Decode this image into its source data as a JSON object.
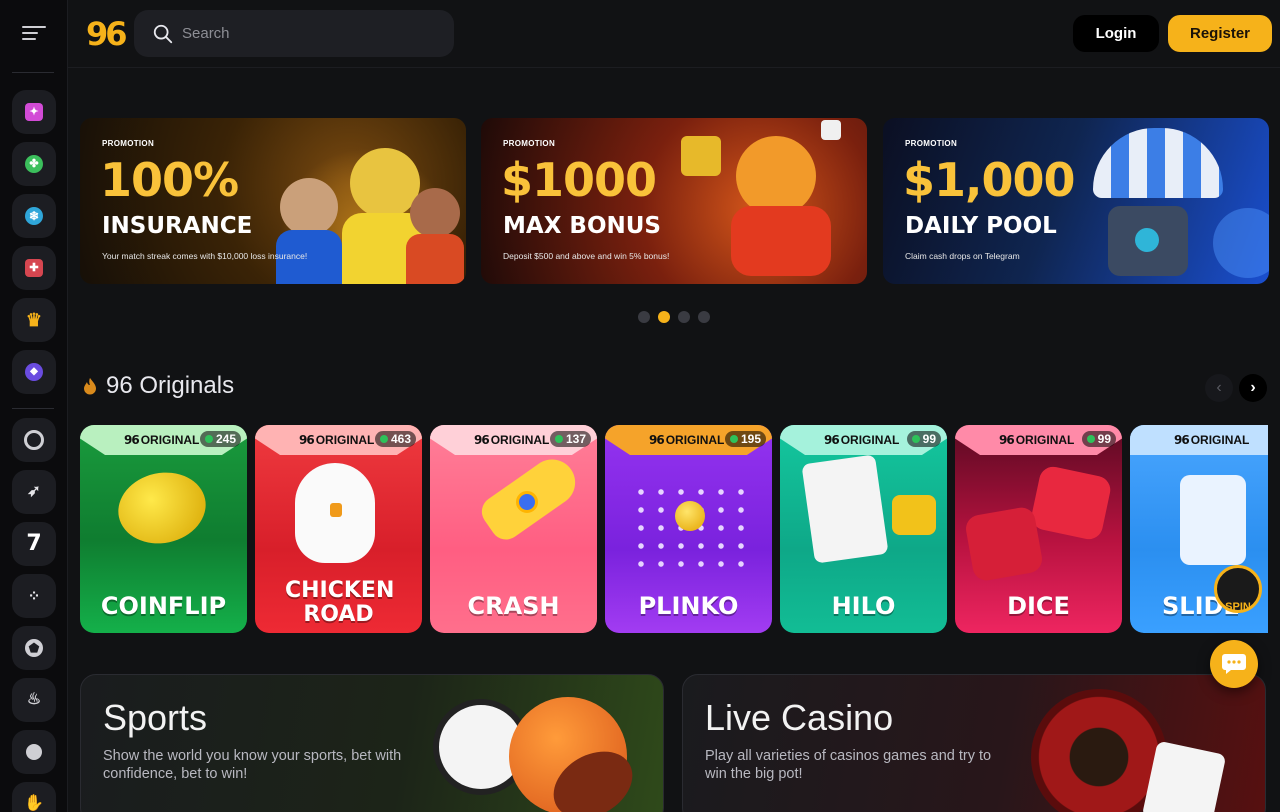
{
  "header": {
    "logo_text": "96",
    "search_placeholder": "Search",
    "login_label": "Login",
    "register_label": "Register"
  },
  "sidebar": {
    "items": [
      {
        "icon": "gift-icon",
        "color": "#d24bd6"
      },
      {
        "icon": "clover-icon",
        "color": "#3bbf5c"
      },
      {
        "icon": "snowflake-icon",
        "color": "#2fa6d9"
      },
      {
        "icon": "present-icon",
        "color": "#d64650"
      },
      {
        "icon": "crown-icon",
        "color": "#f6b21a"
      },
      {
        "icon": "vip-badge-icon",
        "color": "#6a4ce0"
      },
      {
        "icon": "poker-chip-icon",
        "color": "#cfcfd4"
      },
      {
        "icon": "rocket-icon",
        "color": "#cfcfd4"
      },
      {
        "icon": "slot-seven-icon",
        "color": "#cfcfd4"
      },
      {
        "icon": "grid-dots-icon",
        "color": "#cfcfd4"
      },
      {
        "icon": "soccer-ball-icon",
        "color": "#cfcfd4"
      },
      {
        "icon": "fire-icon",
        "color": "#cfcfd4"
      },
      {
        "icon": "ball-icon",
        "color": "#cfcfd4"
      },
      {
        "icon": "hand-icon",
        "color": "#cfcfd4"
      }
    ]
  },
  "banners": [
    {
      "tag": "PROMOTION",
      "headline": "100%",
      "title": "INSURANCE",
      "subtitle": "Your match streak comes with $10,000 loss insurance!"
    },
    {
      "tag": "PROMOTION",
      "headline": "$1000",
      "title": "MAX BONUS",
      "subtitle": "Deposit $500 and above and win 5% bonus!"
    },
    {
      "tag": "PROMOTION",
      "headline": "$1,000",
      "title": "DAILY POOL",
      "subtitle": "Claim cash drops on Telegram"
    }
  ],
  "carousel": {
    "active_index": 1,
    "count": 4
  },
  "originals": {
    "title": "96 Originals",
    "badge_label": "ORIGINAL",
    "badge_logo": "96",
    "games": [
      {
        "name": "COINFLIP",
        "players": "245",
        "color": "#1fae4a"
      },
      {
        "name": "CHICKEN ROAD",
        "players": "463",
        "color": "#e5242b"
      },
      {
        "name": "CRASH",
        "players": "137",
        "color": "#ff6e8a"
      },
      {
        "name": "PLINKO",
        "players": "195",
        "color": "#8a2ee6"
      },
      {
        "name": "HILO",
        "players": "99",
        "color": "#15c39a"
      },
      {
        "name": "DICE",
        "players": "99",
        "color": "#e01f58"
      },
      {
        "name": "SLIDE",
        "players": "",
        "color": "#2b8ff0"
      }
    ]
  },
  "spin_badge": "SPIN",
  "features": [
    {
      "title": "Sports",
      "description": "Show the world you know your sports, bet with confidence, bet to win!"
    },
    {
      "title": "Live Casino",
      "description": "Play all varieties of casinos games and try to win the big pot!"
    }
  ]
}
